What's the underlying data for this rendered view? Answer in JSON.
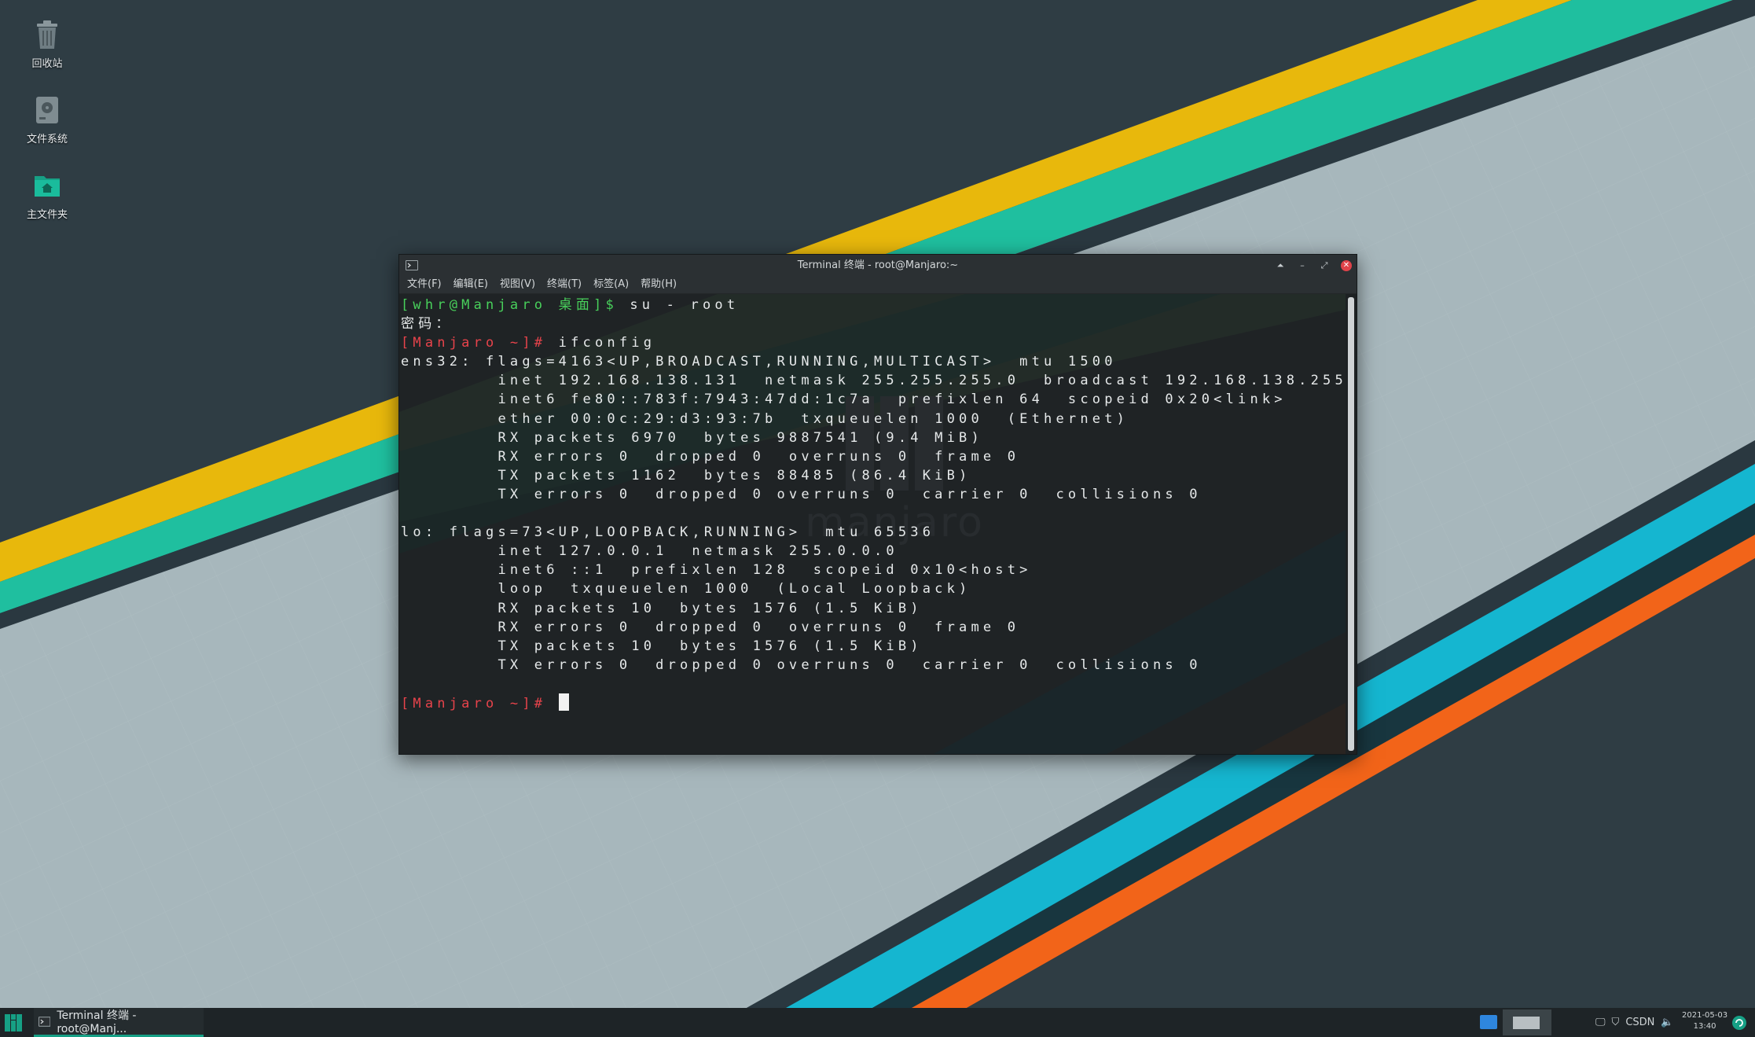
{
  "desktop": {
    "icons": [
      {
        "label": "回收站",
        "icon": "trash-icon"
      },
      {
        "label": "文件系统",
        "icon": "drive-icon"
      },
      {
        "label": "主文件夹",
        "icon": "home-folder-icon"
      }
    ]
  },
  "window": {
    "title": "Terminal 终端 - root@Manjaro:~",
    "menus": [
      "文件(F)",
      "编辑(E)",
      "视图(V)",
      "终端(T)",
      "标签(A)",
      "帮助(H)"
    ]
  },
  "terminal": {
    "watermark": "manjaro",
    "lines": [
      {
        "prompt": "[whr@Manjaro 桌面]$",
        "cmd": " su - root",
        "style": "green"
      },
      {
        "text": "密码："
      },
      {
        "prompt": "[Manjaro ~]#",
        "cmd": " ifconfig",
        "style": "red"
      },
      {
        "text": "ens32: flags=4163<UP,BROADCAST,RUNNING,MULTICAST>  mtu 1500"
      },
      {
        "text": "        inet 192.168.138.131  netmask 255.255.255.0  broadcast 192.168.138.255"
      },
      {
        "text": "        inet6 fe80::783f:7943:47dd:1c7a  prefixlen 64  scopeid 0x20<link>"
      },
      {
        "text": "        ether 00:0c:29:d3:93:7b  txqueuelen 1000  (Ethernet)"
      },
      {
        "text": "        RX packets 6970  bytes 9887541 (9.4 MiB)"
      },
      {
        "text": "        RX errors 0  dropped 0  overruns 0  frame 0"
      },
      {
        "text": "        TX packets 1162  bytes 88485 (86.4 KiB)"
      },
      {
        "text": "        TX errors 0  dropped 0 overruns 0  carrier 0  collisions 0"
      },
      {
        "text": ""
      },
      {
        "text": "lo: flags=73<UP,LOOPBACK,RUNNING>  mtu 65536"
      },
      {
        "text": "        inet 127.0.0.1  netmask 255.0.0.0"
      },
      {
        "text": "        inet6 ::1  prefixlen 128  scopeid 0x10<host>"
      },
      {
        "text": "        loop  txqueuelen 1000  (Local Loopback)"
      },
      {
        "text": "        RX packets 10  bytes 1576 (1.5 KiB)"
      },
      {
        "text": "        RX errors 0  dropped 0  overruns 0  frame 0"
      },
      {
        "text": "        TX packets 10  bytes 1576 (1.5 KiB)"
      },
      {
        "text": "        TX errors 0  dropped 0 overruns 0  carrier 0  collisions 0"
      },
      {
        "text": ""
      },
      {
        "prompt": "[Manjaro ~]#",
        "cmd": " ",
        "style": "red",
        "cursor": true
      }
    ]
  },
  "taskbar": {
    "task_label": "Terminal 终端 - root@Manj...",
    "tray_text": "CSDN",
    "clock_date": "2021-05-03",
    "clock_time": "13:40"
  },
  "colors": {
    "accent": "#16a085",
    "prompt_green": "#48d05b",
    "prompt_red": "#e8434b",
    "stripe_yellow": "#e8b80c",
    "stripe_teal": "#1fbf9f",
    "stripe_cyan": "#15b6d0",
    "stripe_orange": "#f26419"
  }
}
